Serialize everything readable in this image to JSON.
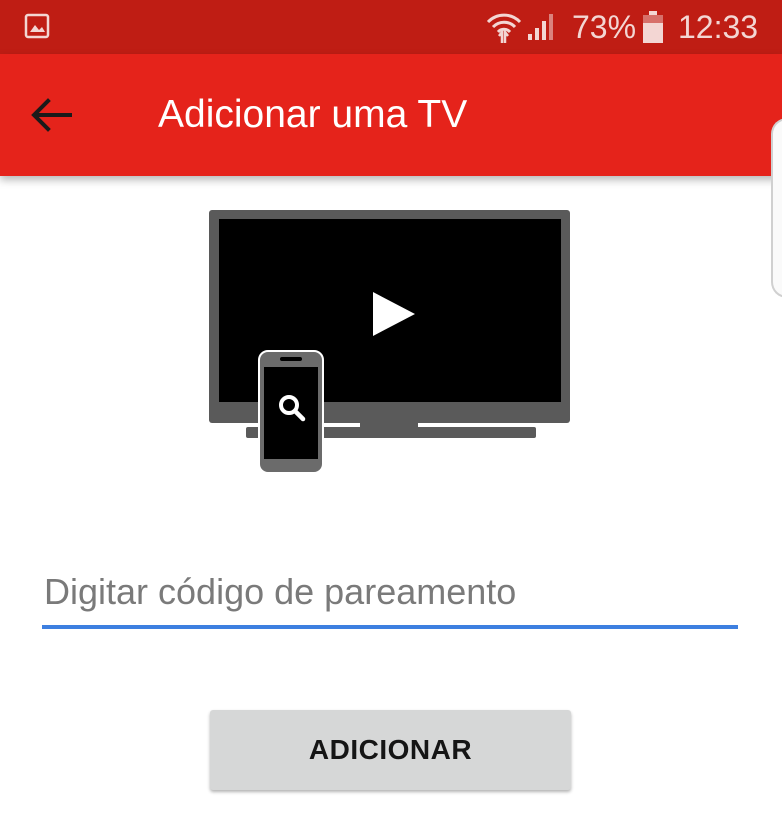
{
  "status_bar": {
    "battery_percent": "73%",
    "time": "12:33",
    "icons": [
      "gallery-icon",
      "wifi-icon",
      "signal-icon",
      "battery-icon"
    ]
  },
  "app_bar": {
    "title": "Adicionar uma TV",
    "back_icon": "arrow-back-icon",
    "color": "#e5231b",
    "status_color": "#bf1d14"
  },
  "illustration": {
    "icons": [
      "tv-icon",
      "play-icon",
      "phone-icon",
      "search-icon"
    ]
  },
  "form": {
    "pairing_code_placeholder": "Digitar código de pareamento",
    "pairing_code_value": "",
    "accent_color": "#3d7fe0"
  },
  "actions": {
    "add_label": "ADICIONAR"
  }
}
